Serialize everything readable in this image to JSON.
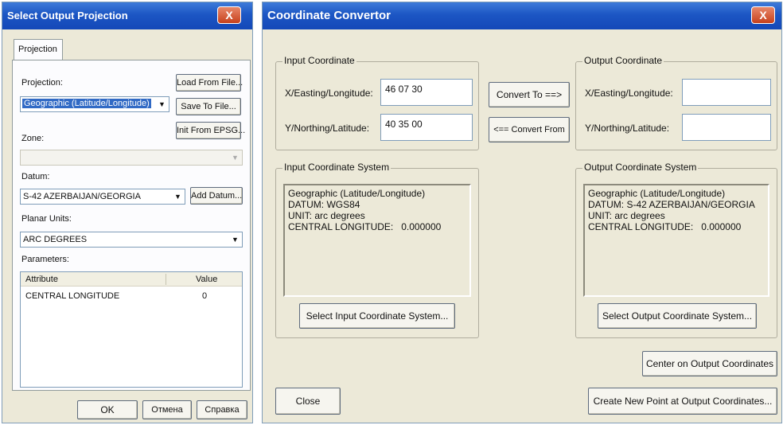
{
  "projection_dialog": {
    "title": "Select Output Projection",
    "close_glyph": "X",
    "tab_label": "Projection",
    "projection_label": "Projection:",
    "projection_value": "Geographic (Latitude/Longitude)",
    "load_button": "Load From File...",
    "save_button": "Save To File...",
    "init_button": "Init From EPSG...",
    "zone_label": "Zone:",
    "zone_value": "",
    "datum_label": "Datum:",
    "datum_value": "S-42 AZERBAIJAN/GEORGIA",
    "add_datum_button": "Add Datum...",
    "planar_units_label": "Planar Units:",
    "planar_units_value": "ARC DEGREES",
    "parameters_label": "Parameters:",
    "param_columns": [
      "Attribute",
      "Value"
    ],
    "param_rows": [
      {
        "attribute": "CENTRAL LONGITUDE",
        "value": "0"
      }
    ],
    "ok_button": "OK",
    "cancel_button": "Отмена",
    "help_button": "Справка"
  },
  "convertor": {
    "title": "Coordinate Convertor",
    "close_glyph": "X",
    "input_coord_group": "Input Coordinate",
    "x_label": "X/Easting/Longitude:",
    "x_value": "46 07 30",
    "y_label": "Y/Northing/Latitude:",
    "y_value": "40 35 00",
    "convert_to_button": "Convert To ==>",
    "convert_from_button": "<== Convert From",
    "output_coord_group": "Output Coordinate",
    "out_x_label": "X/Easting/Longitude:",
    "out_x_value": "",
    "out_y_label": "Y/Northing/Latitude:",
    "out_y_value": "",
    "input_system_group": "Input Coordinate System",
    "input_system_lines": [
      "Geographic (Latitude/Longitude)",
      "DATUM: WGS84",
      "UNIT: arc degrees",
      "CENTRAL LONGITUDE:   0.000000"
    ],
    "select_input_button": "Select Input Coordinate System...",
    "output_system_group": "Output Coordinate System",
    "output_system_lines": [
      "Geographic (Latitude/Longitude)",
      "DATUM: S-42 AZERBAIJAN/GEORGIA",
      "UNIT: arc degrees",
      "CENTRAL LONGITUDE:   0.000000"
    ],
    "select_output_button": "Select Output Coordinate System...",
    "center_button": "Center on Output Coordinates",
    "close_button": "Close",
    "create_point_button": "Create New Point at Output Coordinates..."
  },
  "colors": {
    "title_gradient_top": "#3d7ad9",
    "title_gradient_bottom": "#1448b8",
    "dialog_face": "#ece9d8",
    "selection": "#316ac5"
  }
}
